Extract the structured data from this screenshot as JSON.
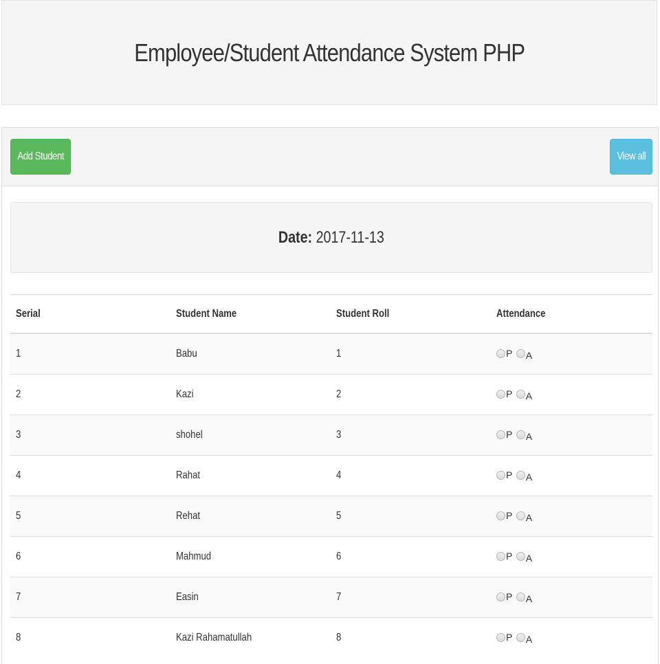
{
  "header": {
    "title": "Employee/Student Attendance System PHP"
  },
  "toolbar": {
    "add_label": "Add Student",
    "view_label": "View all"
  },
  "date": {
    "label": "Date:",
    "value": "2017-11-13"
  },
  "table": {
    "columns": [
      "Serial",
      "Student Name",
      "Student Roll",
      "Attendance"
    ],
    "rows": [
      {
        "serial": "1",
        "name": "Babu",
        "roll": "1"
      },
      {
        "serial": "2",
        "name": "Kazi",
        "roll": "2"
      },
      {
        "serial": "3",
        "name": "shohel",
        "roll": "3"
      },
      {
        "serial": "4",
        "name": "Rahat",
        "roll": "4"
      },
      {
        "serial": "5",
        "name": "Rehat",
        "roll": "5"
      },
      {
        "serial": "6",
        "name": "Mahmud",
        "roll": "6"
      },
      {
        "serial": "7",
        "name": "Easin",
        "roll": "7"
      },
      {
        "serial": "8",
        "name": "Kazi Rahamatullah",
        "roll": "8"
      }
    ],
    "attendance_options": {
      "present": "P",
      "absent": "A"
    }
  },
  "colors": {
    "success": "#5cb85c",
    "info": "#5bc0de",
    "well": "#f5f5f5"
  }
}
